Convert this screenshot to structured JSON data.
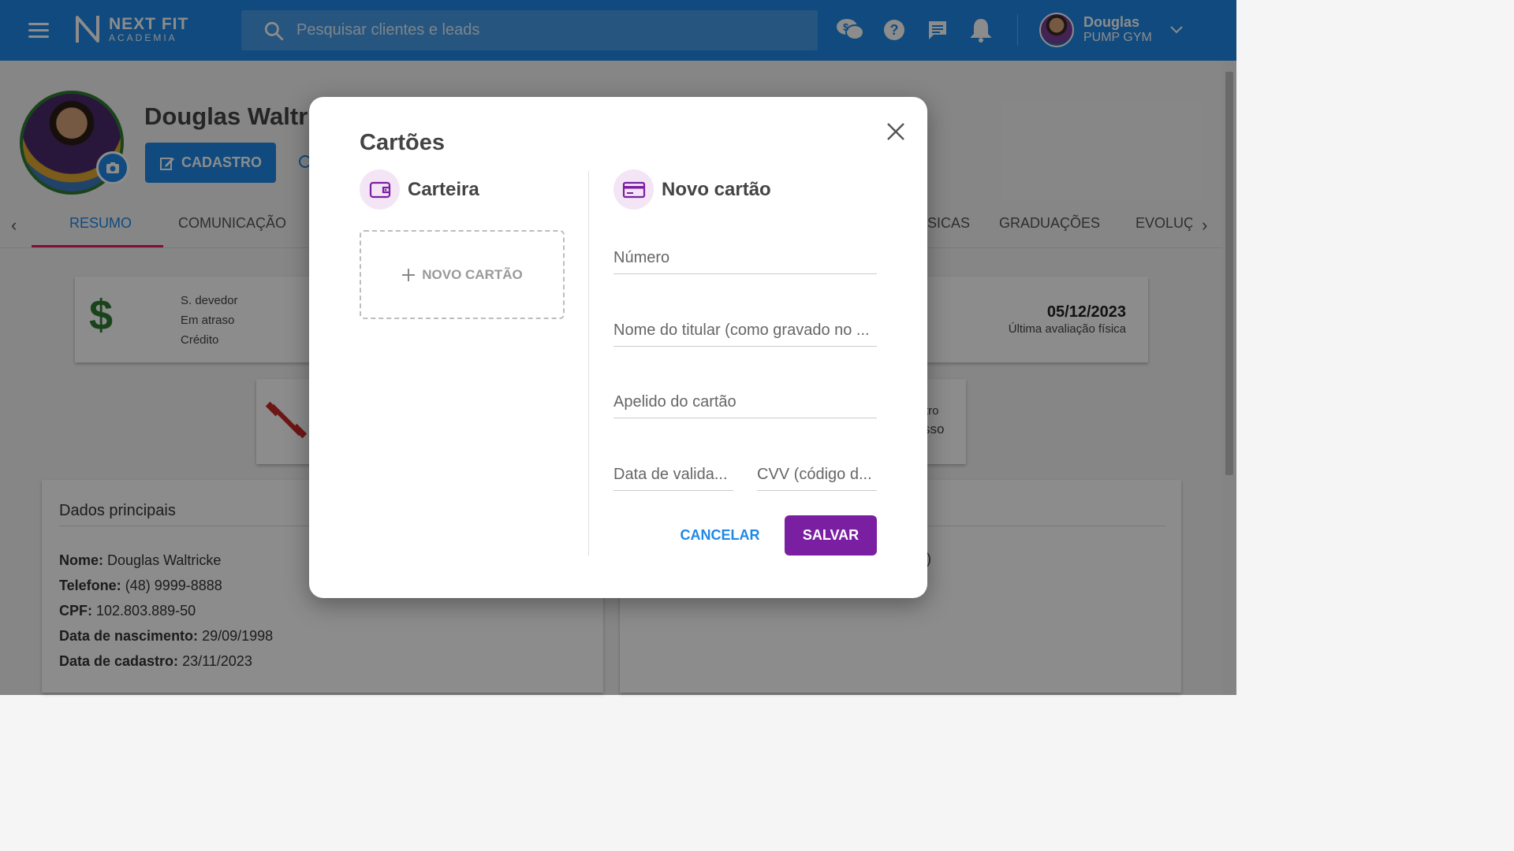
{
  "topbar": {
    "logo_line1": "NEXT FIT",
    "logo_line2": "ACADEMIA",
    "search_placeholder": "Pesquisar clientes e leads",
    "user_name": "Douglas",
    "user_gym": "PUMP GYM"
  },
  "profile": {
    "name": "Douglas Waltric",
    "cadastro_label": "CADASTRO"
  },
  "tabs": [
    {
      "label": "RESUMO",
      "active": true
    },
    {
      "label": "COMUNICAÇÃO"
    },
    {
      "label": "SICAS"
    },
    {
      "label": "GRADUAÇÕES"
    },
    {
      "label": "EVOLUÇ"
    }
  ],
  "summary_card": {
    "symbol": "$",
    "lines": [
      "S. devedor",
      "Em atraso",
      "Crédito"
    ],
    "eval_date": "05/12/2023",
    "eval_label": "Última avaliação física"
  },
  "partial_texts": [
    "tro",
    "sso",
    ")"
  ],
  "dados": {
    "title": "Dados principais",
    "items": [
      {
        "label": "Nome:",
        "value": "Douglas Waltricke"
      },
      {
        "label": "Telefone:",
        "value": "(48) 9999-8888"
      },
      {
        "label": "CPF:",
        "value": "102.803.889-50"
      },
      {
        "label": "Data de nascimento:",
        "value": "29/09/1998"
      },
      {
        "label": "Data de cadastro:",
        "value": "23/11/2023"
      }
    ]
  },
  "modal": {
    "title": "Cartões",
    "wallet_title": "Carteira",
    "new_card_title": "Novo cartão",
    "new_card_button": "NOVO CARTÃO",
    "fields": {
      "number_placeholder": "Número",
      "holder_placeholder": "Nome do titular (como gravado no ...",
      "nickname_placeholder": "Apelido do cartão",
      "expiry_placeholder": "Data de valida...",
      "cvv_placeholder": "CVV (código d..."
    },
    "cancel_label": "CANCELAR",
    "save_label": "SALVAR"
  },
  "colors": {
    "primary": "#1e88e5",
    "accent": "#7b1fa2",
    "tab_underline": "#e91e63",
    "money": "#2e7d32"
  }
}
